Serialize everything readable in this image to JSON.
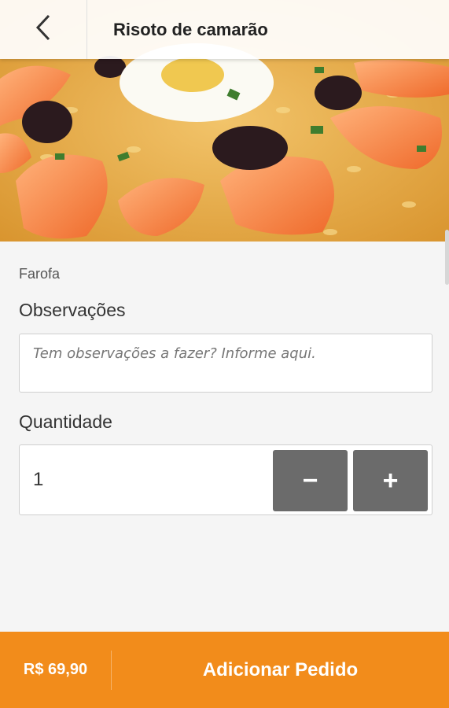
{
  "header": {
    "title": "Risoto de camarão",
    "back_icon": "chevron-left-icon"
  },
  "hero": {
    "image_icon": "dish-photo"
  },
  "item": {
    "side_option": "Farofa"
  },
  "observations": {
    "label": "Observações",
    "placeholder": "Tem observações a fazer?  Informe aqui."
  },
  "quantity": {
    "label": "Quantidade",
    "value": "1",
    "minus_label": "−",
    "plus_label": "+"
  },
  "footer": {
    "price": "R$ 69,90",
    "add_label": "Adicionar Pedido"
  },
  "colors": {
    "accent": "#f28c1b",
    "button_gray": "#6b6b6b"
  }
}
